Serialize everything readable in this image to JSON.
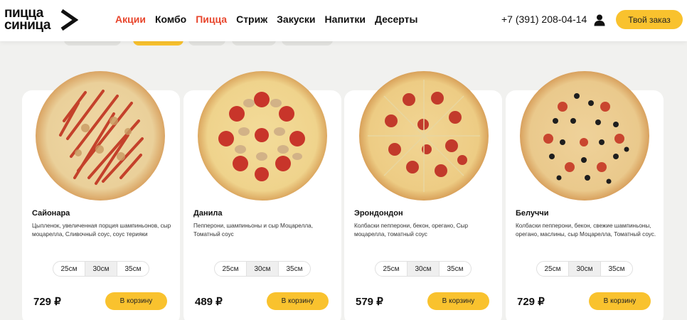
{
  "header": {
    "logo": {
      "line1": "пицца",
      "line2": "синица"
    },
    "nav": [
      "Акции",
      "Комбо",
      "Пицца",
      "Стриж",
      "Закуски",
      "Напитки",
      "Десерты"
    ],
    "phone": "+7 (391) 208-04-14",
    "order_button": "Твой заказ"
  },
  "colors": {
    "accent_yellow": "#f9c22e",
    "nav_red": "#e8462d",
    "background": "#f1f1ef"
  },
  "products": [
    {
      "name": "Сайонара",
      "description": "Цыпленок, увеличенная порция шампиньонов, сыр моцарелла, Сливочный соус, соус терияки",
      "sizes": [
        "25см",
        "30см",
        "35см"
      ],
      "selected_size": "30см",
      "price": "729 ₽",
      "cart_label": "В корзину"
    },
    {
      "name": "Данила",
      "description": "Пепперони, шампиньоны и сыр Моцарелла, Томатный соус",
      "sizes": [
        "25см",
        "30см",
        "35см"
      ],
      "selected_size": "30см",
      "price": "489 ₽",
      "cart_label": "В корзину"
    },
    {
      "name": "Эрондондон",
      "description": "Колбаски пепперони, бекон, орегано, Сыр моцарелла, томатный соус",
      "sizes": [
        "25см",
        "30см",
        "35см"
      ],
      "selected_size": "30см",
      "price": "579 ₽",
      "cart_label": "В корзину"
    },
    {
      "name": "Белуччи",
      "description": "Колбаски пепперони, бекон, свежие шампиньоны, орегано, маслины, сыр Моцарелла, Томатный соус.",
      "sizes": [
        "25см",
        "30см",
        "35см"
      ],
      "selected_size": "30см",
      "price": "729 ₽",
      "cart_label": "В корзину"
    }
  ]
}
